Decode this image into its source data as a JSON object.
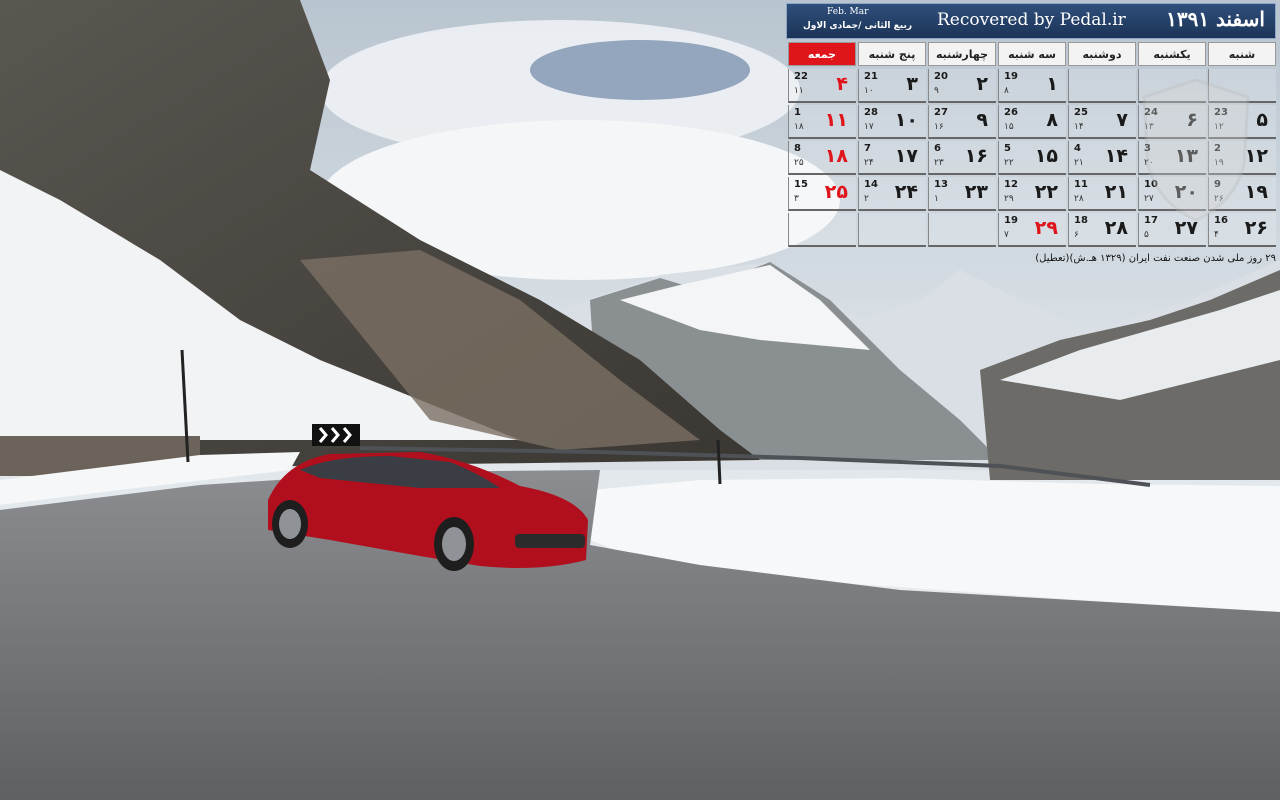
{
  "calendar": {
    "month_title": "اسفند ۱۳۹۱",
    "credit": "Recovered by Pedal.ir",
    "gregorian_months": "Feb. Mar",
    "hijri_months": "ربیع الثانی /جمادی الاول",
    "weekdays": [
      "شنبه",
      "یکشنبه",
      "دوشنبه",
      "سه شنبه",
      "چهارشنبه",
      "پنج شنبه",
      "جمعه"
    ],
    "friday_color": "#e0141b",
    "weeks": [
      [
        null,
        null,
        null,
        {
          "fa": "۱",
          "gd": "19",
          "hj": "۸"
        },
        {
          "fa": "۲",
          "gd": "20",
          "hj": "۹"
        },
        {
          "fa": "۳",
          "gd": "21",
          "hj": "۱۰"
        },
        {
          "fa": "۴",
          "gd": "22",
          "hj": "۱۱"
        }
      ],
      [
        {
          "fa": "۵",
          "gd": "23",
          "hj": "۱۲"
        },
        {
          "fa": "۶",
          "gd": "24",
          "hj": "۱۳"
        },
        {
          "fa": "۷",
          "gd": "25",
          "hj": "۱۴"
        },
        {
          "fa": "۸",
          "gd": "26",
          "hj": "۱۵"
        },
        {
          "fa": "۹",
          "gd": "27",
          "hj": "۱۶"
        },
        {
          "fa": "۱۰",
          "gd": "28",
          "hj": "۱۷"
        },
        {
          "fa": "۱۱",
          "gd": "1",
          "hj": "۱۸"
        }
      ],
      [
        {
          "fa": "۱۲",
          "gd": "2",
          "hj": "۱۹"
        },
        {
          "fa": "۱۳",
          "gd": "3",
          "hj": "۲۰"
        },
        {
          "fa": "۱۴",
          "gd": "4",
          "hj": "۲۱"
        },
        {
          "fa": "۱۵",
          "gd": "5",
          "hj": "۲۲"
        },
        {
          "fa": "۱۶",
          "gd": "6",
          "hj": "۲۳"
        },
        {
          "fa": "۱۷",
          "gd": "7",
          "hj": "۲۴"
        },
        {
          "fa": "۱۸",
          "gd": "8",
          "hj": "۲۵"
        }
      ],
      [
        {
          "fa": "۱۹",
          "gd": "9",
          "hj": "۲۶"
        },
        {
          "fa": "۲۰",
          "gd": "10",
          "hj": "۲۷"
        },
        {
          "fa": "۲۱",
          "gd": "11",
          "hj": "۲۸"
        },
        {
          "fa": "۲۲",
          "gd": "12",
          "hj": "۲۹"
        },
        {
          "fa": "۲۳",
          "gd": "13",
          "hj": "۱"
        },
        {
          "fa": "۲۴",
          "gd": "14",
          "hj": "۲"
        },
        {
          "fa": "۲۵",
          "gd": "15",
          "hj": "۳"
        }
      ],
      [
        {
          "fa": "۲۶",
          "gd": "16",
          "hj": "۴"
        },
        {
          "fa": "۲۷",
          "gd": "17",
          "hj": "۵"
        },
        {
          "fa": "۲۸",
          "gd": "18",
          "hj": "۶"
        },
        {
          "fa": "۲۹",
          "gd": "19",
          "hj": "۷",
          "holiday": true
        },
        {
          "empty": true
        },
        {
          "empty": true
        },
        {
          "empty": true
        }
      ]
    ],
    "note": "۲۹ روز ملی شدن صنعت نفت ایران (۱۳۲۹ هـ.ش)(تعطیل)"
  },
  "scene": {
    "sky_color": "#c9d3dc",
    "snow_color": "#f1f4f6",
    "car_color": "#c0111f",
    "road_color": "#6e6f70"
  }
}
